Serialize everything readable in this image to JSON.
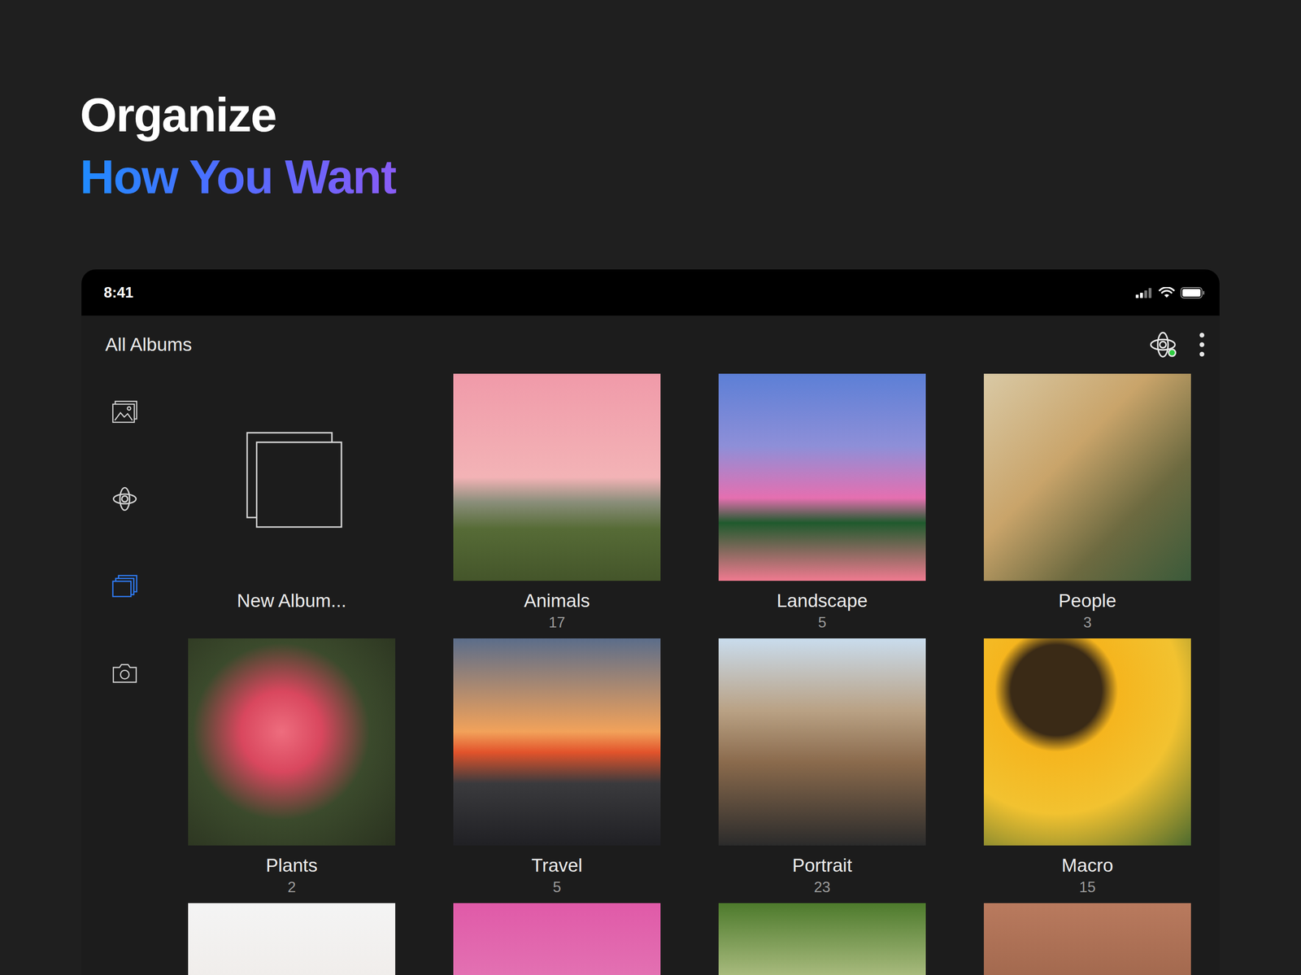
{
  "headline": {
    "line1": "Organize",
    "line2": "How You Want"
  },
  "status_bar": {
    "time": "8:41"
  },
  "app_bar": {
    "title": "All Albums",
    "sync_active": true
  },
  "sidebar": {
    "items": [
      {
        "kind": "photos",
        "selected": false
      },
      {
        "kind": "explore",
        "selected": false
      },
      {
        "kind": "albums",
        "selected": true
      },
      {
        "kind": "camera",
        "selected": false
      }
    ]
  },
  "albums": [
    {
      "kind": "new",
      "name": "New Album..."
    },
    {
      "kind": "album",
      "name": "Animals",
      "count": "17"
    },
    {
      "kind": "album",
      "name": "Landscape",
      "count": "5"
    },
    {
      "kind": "album",
      "name": "People",
      "count": "3"
    },
    {
      "kind": "album",
      "name": "Plants",
      "count": "2"
    },
    {
      "kind": "album",
      "name": "Travel",
      "count": "5"
    },
    {
      "kind": "album",
      "name": "Portrait",
      "count": "23"
    },
    {
      "kind": "album",
      "name": "Macro",
      "count": "15"
    },
    {
      "kind": "partial"
    },
    {
      "kind": "partial"
    },
    {
      "kind": "partial"
    },
    {
      "kind": "partial"
    }
  ]
}
